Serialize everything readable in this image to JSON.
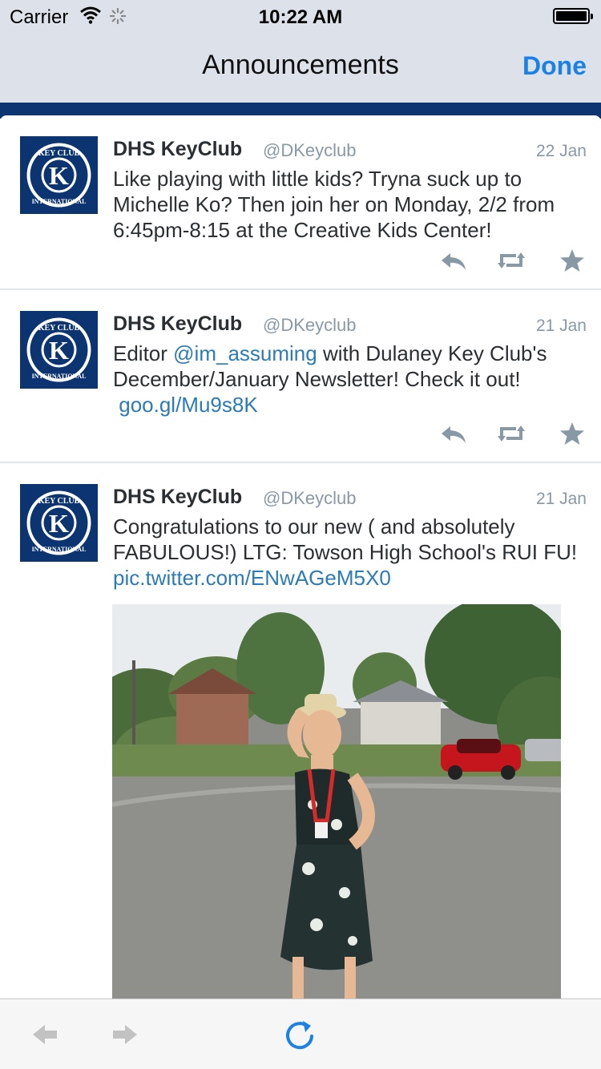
{
  "status_bar": {
    "carrier": "Carrier",
    "time": "10:22 AM"
  },
  "nav": {
    "title": "Announcements",
    "done_label": "Done"
  },
  "colors": {
    "accent": "#1a82e6",
    "link": "#2b7bb9",
    "band": "#0b3470",
    "muted": "#8899a6"
  },
  "tweets": [
    {
      "name": "DHS KeyClub",
      "handle": "@DKeyclub",
      "date": "22 Jan",
      "text": "Like playing with little kids? Tryna suck up to Michelle Ko? Then join her on Monday, 2/2 from 6:45pm-8:15 at the Creative Kids Center!"
    },
    {
      "name": "DHS KeyClub",
      "handle": "@DKeyclub",
      "date": "21 Jan",
      "text_before": "Editor ",
      "mention": "@im_assuming",
      "text_after": " with Dulaney Key Club's December/January Newsletter! Check it out!",
      "link": "goo.gl/Mu9s8K"
    },
    {
      "name": "DHS KeyClub",
      "handle": "@DKeyclub",
      "date": "21 Jan",
      "text_before": "Congratulations to our new ( and absolutely FABULOUS!) LTG: Towson High School's RUI FU! ",
      "link": "pic.twitter.com/ENwAGeM5X0"
    }
  ],
  "avatar": {
    "logo_text_top": "KEY CLUB",
    "logo_text_bottom": "INTERNATIONAL",
    "logo_letter": "K"
  },
  "icons": {
    "reply": "reply-icon",
    "retweet": "retweet-icon",
    "favorite": "star-icon",
    "back": "back-arrow-icon",
    "forward": "forward-arrow-icon",
    "reload": "reload-icon"
  }
}
